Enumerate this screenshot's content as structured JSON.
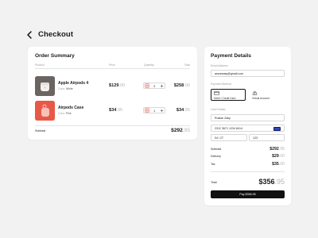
{
  "page": {
    "title": "Checkout"
  },
  "order": {
    "title": "Order Summary",
    "columns": {
      "product": "Product",
      "price": "Price",
      "quantity": "Quantity",
      "total": "Total"
    },
    "items": [
      {
        "name": "Apple Airpods 4",
        "color_label": "Color:",
        "color": "White",
        "price_main": "$129",
        "price_cents": ".00",
        "quantity": "2",
        "total_main": "$258",
        "total_cents": ".00"
      },
      {
        "name": "Airpods Case",
        "color_label": "Color:",
        "color": "Pink",
        "price_main": "$34",
        "price_cents": ".95",
        "quantity": "1",
        "total_main": "$34",
        "total_cents": ".95"
      }
    ],
    "subtotal_label": "Subtotal",
    "subtotal_main": "$292",
    "subtotal_cents": ".95"
  },
  "payment": {
    "title": "Payment Details",
    "email_label": "Email Address",
    "email_value": "aszarsasy@gmail.com",
    "method_label": "Payment Method",
    "methods": [
      {
        "label": "Debit / Credit Card",
        "icon": "credit-card-icon",
        "selected": true
      },
      {
        "label": "Virtual Account",
        "icon": "bank-icon",
        "selected": false
      }
    ],
    "card_details_label": "Card Details",
    "card_name": "Ruslan Zaky",
    "card_number": "2312 3671 1234 8414",
    "card_brand_icon": "card-brand-icon",
    "expiry": "04 / 27",
    "cvv": "123",
    "summary": [
      {
        "label": "Subtotal",
        "main": "$292",
        "cents": ".95"
      },
      {
        "label": "Delivery",
        "main": "$29",
        "cents": ".00"
      },
      {
        "label": "Tax",
        "main": "$35",
        "cents": ".00"
      }
    ],
    "total_label": "Total",
    "total_main": "$356",
    "total_cents": ".95",
    "pay_label": "Pay $356.95"
  },
  "colors": {
    "background": "#f2f2f3",
    "card": "#ffffff",
    "primary": "#111111",
    "accent_red": "#e85848",
    "muted": "#b5b5b5"
  }
}
